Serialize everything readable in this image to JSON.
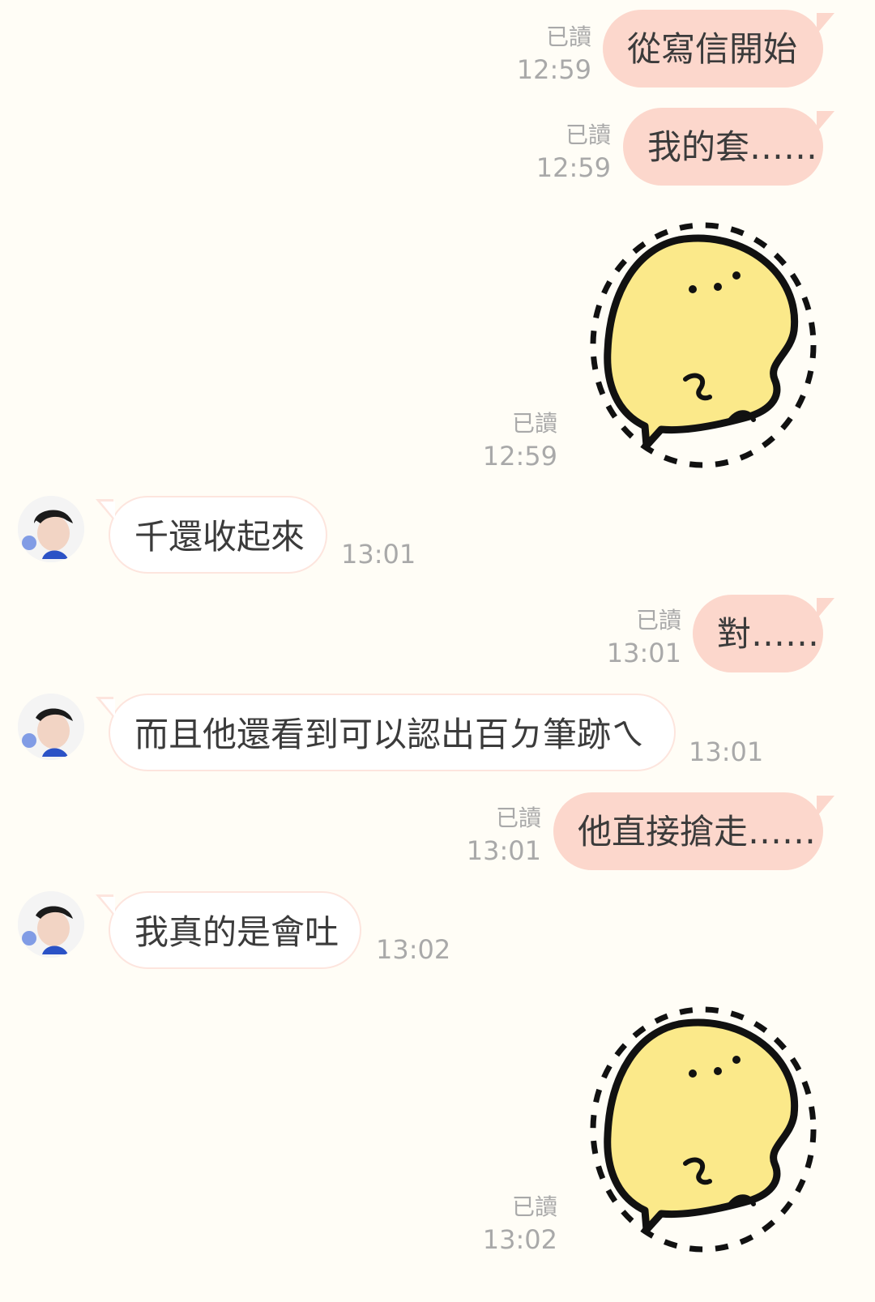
{
  "messages": {
    "m1": {
      "text": "從寫信開始",
      "read": "已讀",
      "time": "12:59"
    },
    "m2": {
      "text": "我的套……",
      "read": "已讀",
      "time": "12:59"
    },
    "m3": {
      "sticker": "yellow-blob-sticker",
      "read": "已讀",
      "time": "12:59"
    },
    "m4": {
      "text": "千還收起來",
      "time": "13:01"
    },
    "m5": {
      "text": "對……",
      "read": "已讀",
      "time": "13:01"
    },
    "m6": {
      "text": "而且他還看到可以認出百ㄉ筆跡ㄟ",
      "time": "13:01"
    },
    "m7": {
      "text": "他直接搶走……",
      "read": "已讀",
      "time": "13:01"
    },
    "m8": {
      "text": "我真的是會吐",
      "time": "13:02"
    },
    "m9": {
      "sticker": "yellow-blob-sticker",
      "read": "已讀",
      "time": "13:02"
    }
  },
  "colors": {
    "background": "#fffdf6",
    "my_bubble": "#fcd7cc",
    "other_bubble": "#ffffff",
    "other_border": "#fde5de",
    "meta_text": "#a9a9a9",
    "sticker_fill": "#fbe98a"
  },
  "icons": {
    "avatar": "contact-avatar-illustration",
    "sticker": "yellow-blob-sticker"
  }
}
